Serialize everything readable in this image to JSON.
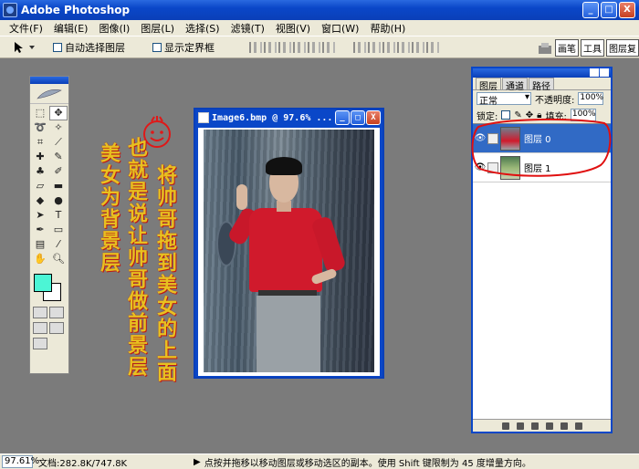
{
  "app": {
    "title": "Adobe Photoshop"
  },
  "window_buttons": {
    "minimize": "_",
    "maximize": "□",
    "close": "X"
  },
  "menubar": [
    "文件(F)",
    "编辑(E)",
    "图像(I)",
    "图层(L)",
    "选择(S)",
    "滤镜(T)",
    "视图(V)",
    "窗口(W)",
    "帮助(H)"
  ],
  "options": {
    "auto_select_layer": "自动选择图层",
    "show_bounding_box": "显示定界框",
    "palette_tabs": [
      "画笔",
      "工具",
      "图层复"
    ]
  },
  "document": {
    "title": "Image6.bmp @ 97.6% ...",
    "buttons": {
      "minimize": "_",
      "maximize": "□",
      "close": "X"
    }
  },
  "annotations": {
    "col1": "将帅哥拖到美女的上面",
    "col2": "也就是说让帅哥做前景层",
    "col3": "美女为背景层"
  },
  "layers_panel": {
    "tabs": [
      "图层",
      "通道",
      "路径"
    ],
    "blend_mode": "正常",
    "opacity_label": "不透明度:",
    "opacity_value": "100%",
    "lock_label": "锁定:",
    "fill_label": "填充:",
    "fill_value": "100%",
    "layers": [
      {
        "name": "图层 0",
        "selected": true
      },
      {
        "name": "图层 1",
        "selected": false
      }
    ]
  },
  "toolbox": {
    "foreground_color": "#4cf5d5",
    "background_color": "#ffffff"
  },
  "statusbar": {
    "zoom": "97.61%",
    "doc_size": "文档:282.8K/747.8K",
    "hint": "点按并拖移以移动图层或移动选区的副本。使用 Shift 键限制为 45 度增量方向。"
  },
  "colors": {
    "title_blue": "#0a47c8",
    "annotation_text": "#e8c020",
    "annotation_outline": "#c01818",
    "loop_red": "#e01010"
  }
}
